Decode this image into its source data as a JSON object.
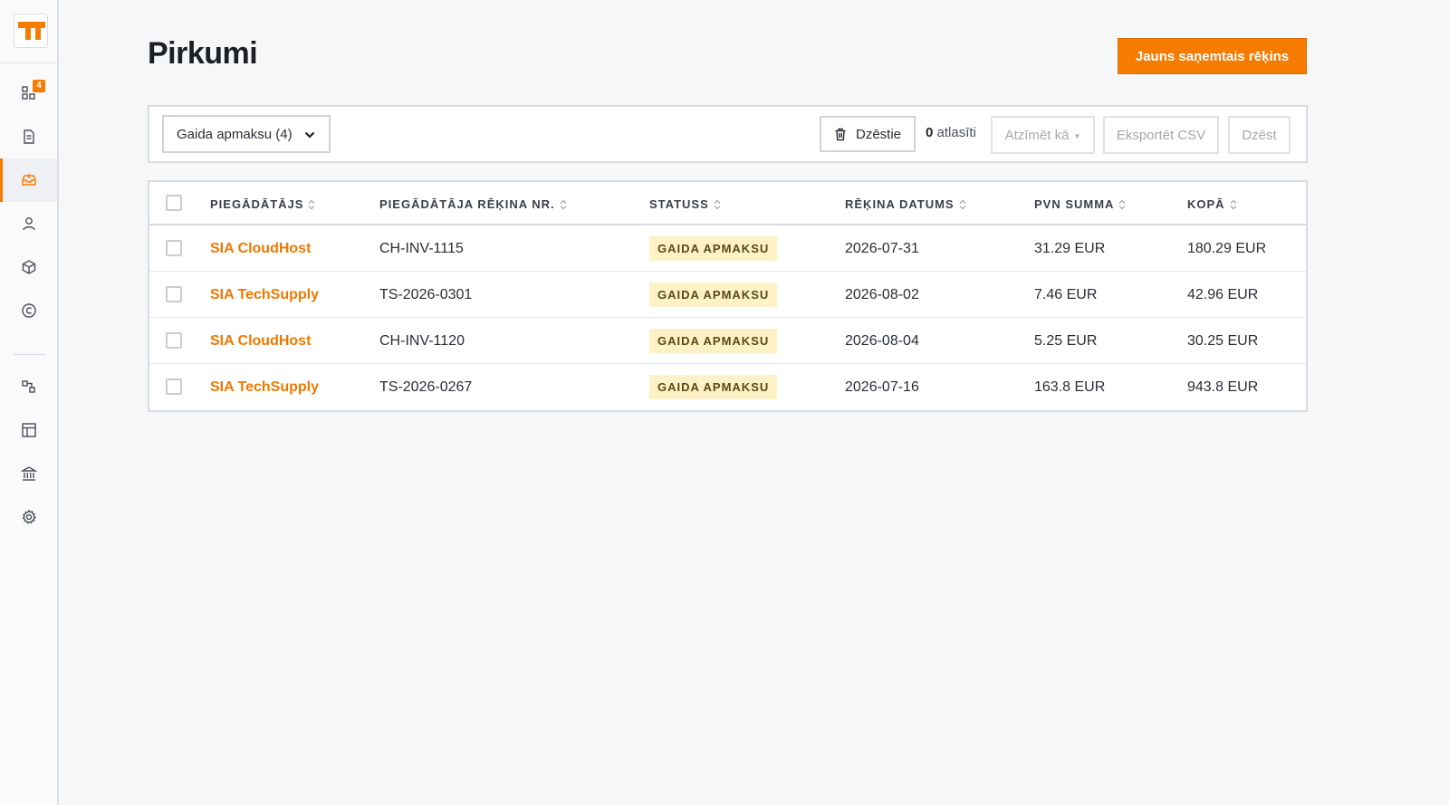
{
  "app": {
    "brand_color": "#f57c00",
    "logo": "logo-icon"
  },
  "sidebar": {
    "items": [
      {
        "icon": "dashboard-icon",
        "badge": "4"
      },
      {
        "icon": "document-icon"
      },
      {
        "icon": "inbox-icon",
        "active": true
      },
      {
        "icon": "user-icon"
      },
      {
        "icon": "box-icon"
      },
      {
        "icon": "copyright-icon"
      },
      {
        "icon": "shapes-icon"
      },
      {
        "icon": "layout-icon"
      },
      {
        "icon": "bank-icon"
      },
      {
        "icon": "gear-icon"
      }
    ]
  },
  "page": {
    "title": "Pirkumi",
    "primary_action": "Jauns saņemtais rēķins"
  },
  "toolbar": {
    "filter_value": "Gaida apmaksu (4)",
    "trash_label": "Dzēstie",
    "selected_count": "0",
    "selected_label": "atlasīti",
    "mark_as_label": "Atzīmēt kā",
    "export_label": "Eksportēt CSV",
    "delete_label": "Dzēst"
  },
  "table": {
    "columns": [
      "PIEGĀDĀTĀJS",
      "PIEGĀDĀTĀJA RĒĶINA NR.",
      "STATUSS",
      "RĒĶINA DATUMS",
      "PVN SUMMA",
      "KOPĀ"
    ],
    "rows": [
      {
        "supplier": "SIA CloudHost",
        "invoice_no": "CH-INV-1115",
        "status": "GAIDA APMAKSU",
        "date": "2026-07-31",
        "vat": "31.29 EUR",
        "total": "180.29 EUR"
      },
      {
        "supplier": "SIA TechSupply",
        "invoice_no": "TS-2026-0301",
        "status": "GAIDA APMAKSU",
        "date": "2026-08-02",
        "vat": "7.46 EUR",
        "total": "42.96 EUR"
      },
      {
        "supplier": "SIA CloudHost",
        "invoice_no": "CH-INV-1120",
        "status": "GAIDA APMAKSU",
        "date": "2026-08-04",
        "vat": "5.25 EUR",
        "total": "30.25 EUR"
      },
      {
        "supplier": "SIA TechSupply",
        "invoice_no": "TS-2026-0267",
        "status": "GAIDA APMAKSU",
        "date": "2026-07-16",
        "vat": "163.8 EUR",
        "total": "943.8 EUR"
      }
    ]
  }
}
